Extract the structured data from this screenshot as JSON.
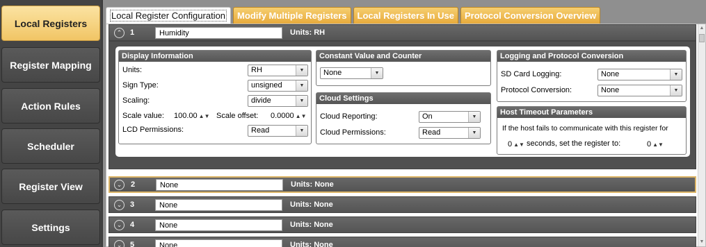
{
  "nav": {
    "items": [
      {
        "label": "Local Registers"
      },
      {
        "label": "Register Mapping"
      },
      {
        "label": "Action Rules"
      },
      {
        "label": "Scheduler"
      },
      {
        "label": "Register View"
      },
      {
        "label": "Settings"
      }
    ]
  },
  "tabs": [
    {
      "label": "Local Register Configuration"
    },
    {
      "label": "Modify Multiple Registers"
    },
    {
      "label": "Local Registers In Use"
    },
    {
      "label": "Protocol Conversion Overview"
    }
  ],
  "registers": [
    {
      "number": "1",
      "name": "Humidity",
      "units": "Units: RH"
    },
    {
      "number": "2",
      "name": "None",
      "units": "Units: None"
    },
    {
      "number": "3",
      "name": "None",
      "units": "Units: None"
    },
    {
      "number": "4",
      "name": "None",
      "units": "Units: None"
    },
    {
      "number": "5",
      "name": "None",
      "units": "Units: None"
    }
  ],
  "display": {
    "title": "Display Information",
    "units_label": "Units:",
    "units_value": "RH",
    "sign_label": "Sign Type:",
    "sign_value": "unsigned",
    "scaling_label": "Scaling:",
    "scaling_value": "divide",
    "scale_value_label": "Scale value:",
    "scale_value": "100.00",
    "scale_offset_label": "Scale offset:",
    "scale_offset": "0.0000",
    "lcd_label": "LCD Permissions:",
    "lcd_value": "Read"
  },
  "constant": {
    "title": "Constant Value and Counter",
    "value": "None"
  },
  "cloud": {
    "title": "Cloud Settings",
    "reporting_label": "Cloud Reporting:",
    "reporting_value": "On",
    "permissions_label": "Cloud Permissions:",
    "permissions_value": "Read"
  },
  "logging": {
    "title": "Logging and Protocol Conversion",
    "sd_label": "SD Card Logging:",
    "sd_value": "None",
    "protocol_label": "Protocol Conversion:",
    "protocol_value": "None"
  },
  "timeout": {
    "title": "Host Timeout Parameters",
    "text1": "If the host fails to communicate with this register for",
    "seconds_value": "0",
    "text2": "seconds, set the register to:",
    "set_value": "0"
  },
  "icons": {
    "spin": "▲▼",
    "dropdown": "▼",
    "collapse": "⌃",
    "expand": "⌄"
  },
  "colors": {
    "accent": "#f1c565",
    "header": "#5a5a5a"
  }
}
